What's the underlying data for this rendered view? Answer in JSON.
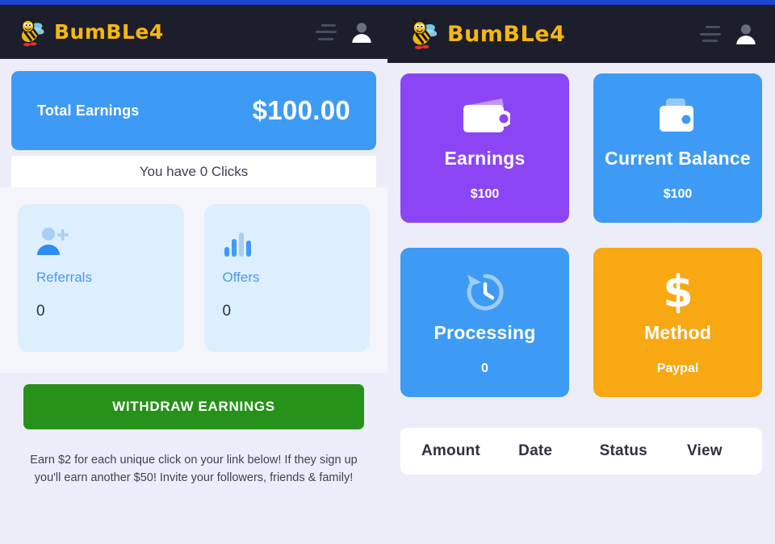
{
  "brand": {
    "name": "BumBLe4",
    "logo_icon": "bee-icon",
    "menu_icon": "hamburger-icon",
    "account_icon": "user-avatar-icon"
  },
  "left_panel": {
    "total_earnings": {
      "label": "Total Earnings",
      "amount": "$100.00"
    },
    "clicks_bar": "You have 0 Clicks",
    "stats": [
      {
        "icon": "user-plus-icon",
        "title": "Referrals",
        "value": "0"
      },
      {
        "icon": "bar-chart-icon",
        "title": "Offers",
        "value": "0"
      }
    ],
    "withdraw_button": "WITHDRAW EARNINGS",
    "promo_text": "Earn $2 for each unique click on your link below! If they sign up you'll earn another $50! Invite your followers, friends & family!"
  },
  "right_panel": {
    "tiles": [
      {
        "icon": "wallet-icon",
        "title": "Earnings",
        "value": "$100",
        "color": "#8b45f5"
      },
      {
        "icon": "wallet-icon",
        "title": "Current Balance",
        "value": "$100",
        "color": "#3d9bf6"
      },
      {
        "icon": "history-icon",
        "title": "Processing",
        "value": "0",
        "color": "#3d9bf6"
      },
      {
        "icon": "dollar-icon",
        "title": "Method",
        "value": "Paypal",
        "color": "#f7a813"
      }
    ],
    "transactions_table": {
      "columns": [
        "Amount",
        "Date",
        "Status",
        "View"
      ]
    }
  },
  "theme": {
    "page_bg": "#ecedf9",
    "header_bg": "#1d1e2c",
    "brand_yellow": "#f5b711",
    "accent_blue": "#3d9bf6",
    "purple": "#8b45f5",
    "orange": "#f7a813",
    "green": "#27921a",
    "top_strip": "#1b44d0"
  }
}
